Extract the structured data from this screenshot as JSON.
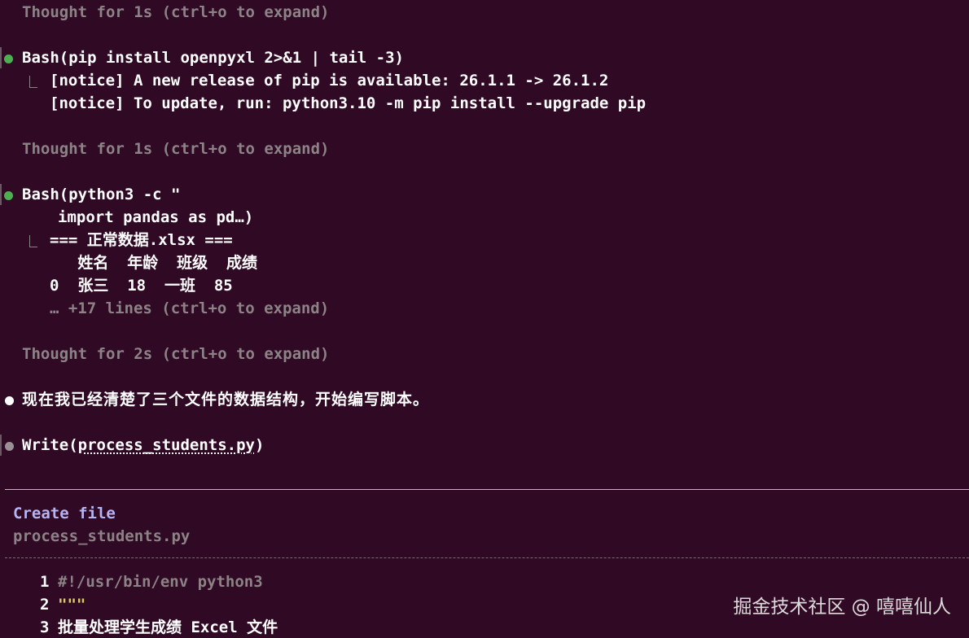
{
  "colors": {
    "background": "#300a24",
    "muted_text": "#8c8386",
    "accent_lavender": "#b7b4f2",
    "bullet_green": "#4caf50",
    "docstring_yellow": "#d8c86a"
  },
  "transcript": {
    "thought_1": "Thought for 1s (ctrl+o to expand)",
    "bash_1": {
      "command": "Bash(pip install openpyxl 2>&1 | tail -3)",
      "output_1": "[notice] A new release of pip is available: 26.1.1 -> 26.1.2",
      "output_2": "[notice] To update, run: python3.10 -m pip install --upgrade pip"
    },
    "thought_2": "Thought for 1s (ctrl+o to expand)",
    "bash_2": {
      "command_line_1": "Bash(python3 -c \"",
      "command_line_2": "import pandas as pd…)",
      "output_1": "=== 正常数据.xlsx ===",
      "output_2": "   姓名  年龄  班级  成绩",
      "output_3": "0  张三  18  一班  85",
      "output_more": "… +17 lines (ctrl+o to expand)"
    },
    "thought_3": "Thought for 2s (ctrl+o to expand)",
    "message": "现在我已经清楚了三个文件的数据结构，开始编写脚本。",
    "write_call": {
      "prefix": "Write(",
      "filename": "process_students.py",
      "suffix": ")"
    }
  },
  "create_panel": {
    "title": "Create file",
    "filename": "process_students.py",
    "code_lines": [
      {
        "number": "1",
        "text": "#!/usr/bin/env python3"
      },
      {
        "number": "2",
        "text": "\"\"\""
      },
      {
        "number": "3",
        "text": "批量处理学生成绩 Excel 文件"
      }
    ]
  },
  "watermark": "掘金技术社区 @ 嘻嘻仙人"
}
